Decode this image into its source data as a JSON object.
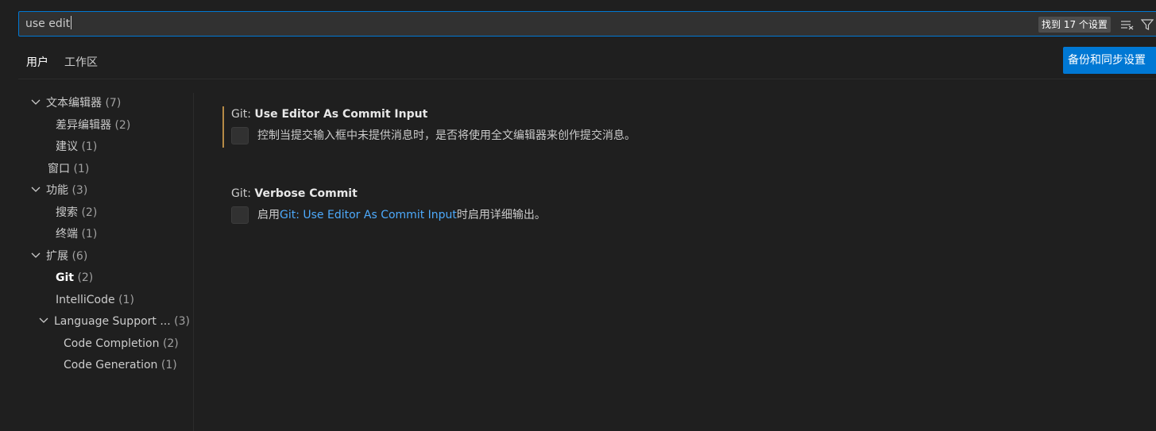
{
  "search": {
    "value": "use edit",
    "result_badge": "找到 17 个设置",
    "clear_icon": "clear-filter-icon",
    "filter_icon": "filter-icon"
  },
  "tabs": [
    {
      "label": "用户",
      "active": true
    },
    {
      "label": "工作区",
      "active": false
    }
  ],
  "sync_button_label": "备份和同步设置",
  "toc": [
    {
      "label": "文本编辑器",
      "count": "(7)",
      "expanded": true,
      "level": 0
    },
    {
      "label": "差异编辑器",
      "count": "(2)",
      "level": 1
    },
    {
      "label": "建议",
      "count": "(1)",
      "level": 1
    },
    {
      "label": "窗口",
      "count": "(1)",
      "level": 0
    },
    {
      "label": "功能",
      "count": "(3)",
      "expanded": true,
      "level": 0
    },
    {
      "label": "搜索",
      "count": "(2)",
      "level": 1
    },
    {
      "label": "终端",
      "count": "(1)",
      "level": 1
    },
    {
      "label": "扩展",
      "count": "(6)",
      "expanded": true,
      "level": 0
    },
    {
      "label": "Git",
      "count": "(2)",
      "level": 1,
      "selected": true
    },
    {
      "label": "IntelliCode",
      "count": "(1)",
      "level": 1
    },
    {
      "label": "Language Support ...",
      "count": "(3)",
      "expanded": true,
      "level": 1
    },
    {
      "label": "Code Completion",
      "count": "(2)",
      "level": 2
    },
    {
      "label": "Code Generation",
      "count": "(1)",
      "level": 2
    }
  ],
  "settings": [
    {
      "category": "Git: ",
      "key": "Use Editor As Commit Input",
      "checked": false,
      "modified": true,
      "desc_pre": "控制当提交输入框中未提供消息时，是否将使用全文编辑器来创作提交消息。",
      "desc_link": "",
      "desc_post": ""
    },
    {
      "category": "Git: ",
      "key": "Verbose Commit",
      "checked": false,
      "modified": false,
      "desc_pre": "启用",
      "desc_link": "Git: Use Editor As Commit Input",
      "desc_post": "时启用详细输出。"
    }
  ],
  "colors": {
    "accent": "#0078d4",
    "link": "#4daafc",
    "modified_indicator": "#b58a46",
    "background": "#1f1f1f"
  }
}
